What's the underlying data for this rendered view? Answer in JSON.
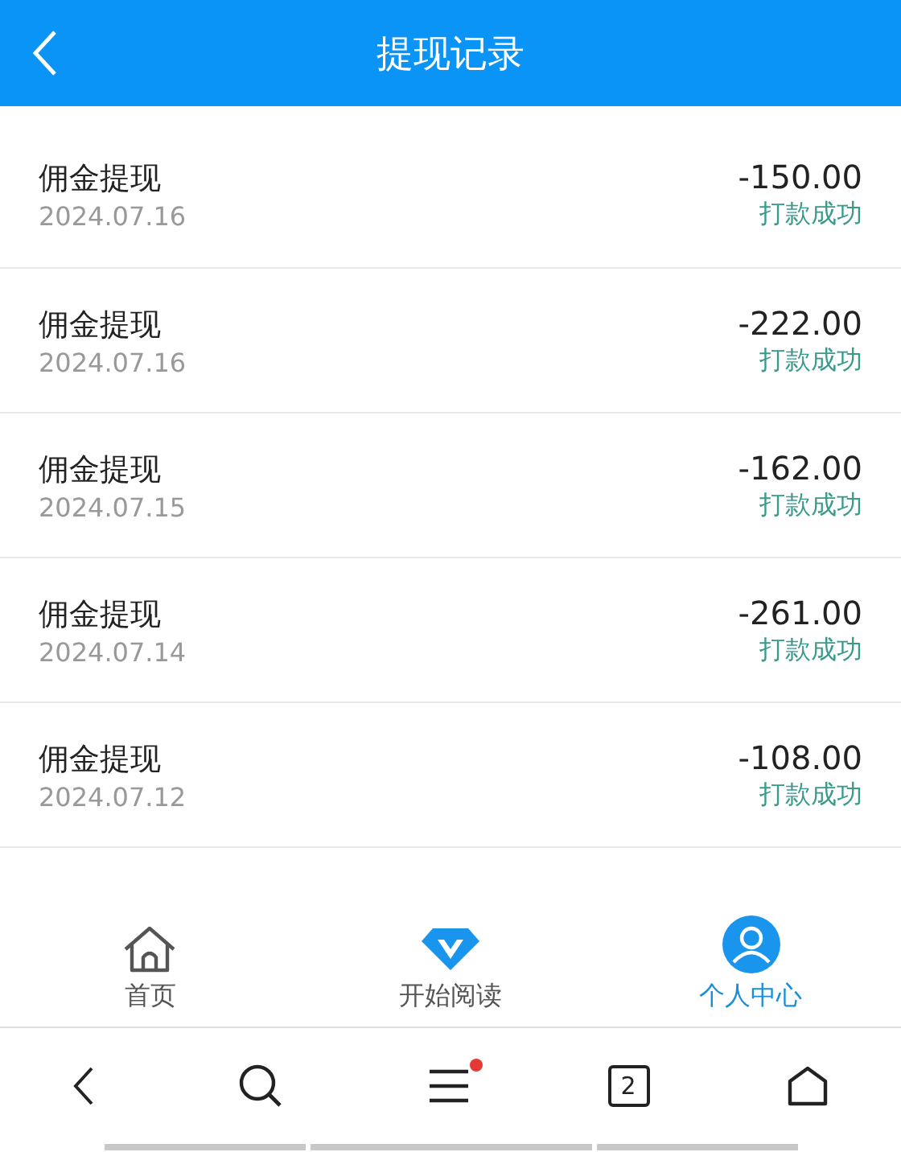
{
  "header": {
    "title": "提现记录"
  },
  "records": [
    {
      "title": "佣金提现",
      "date": "2024.07.16",
      "amount": "-150.00",
      "status": "打款成功"
    },
    {
      "title": "佣金提现",
      "date": "2024.07.16",
      "amount": "-222.00",
      "status": "打款成功"
    },
    {
      "title": "佣金提现",
      "date": "2024.07.15",
      "amount": "-162.00",
      "status": "打款成功"
    },
    {
      "title": "佣金提现",
      "date": "2024.07.14",
      "amount": "-261.00",
      "status": "打款成功"
    },
    {
      "title": "佣金提现",
      "date": "2024.07.12",
      "amount": "-108.00",
      "status": "打款成功"
    }
  ],
  "tabbar": [
    {
      "label": "首页",
      "kind": "home",
      "selected": false
    },
    {
      "label": "开始阅读",
      "kind": "diamond",
      "selected": false
    },
    {
      "label": "个人中心",
      "kind": "user",
      "selected": true
    }
  ],
  "browser_bar": {
    "tab_count": "2",
    "menu_badge": true
  }
}
